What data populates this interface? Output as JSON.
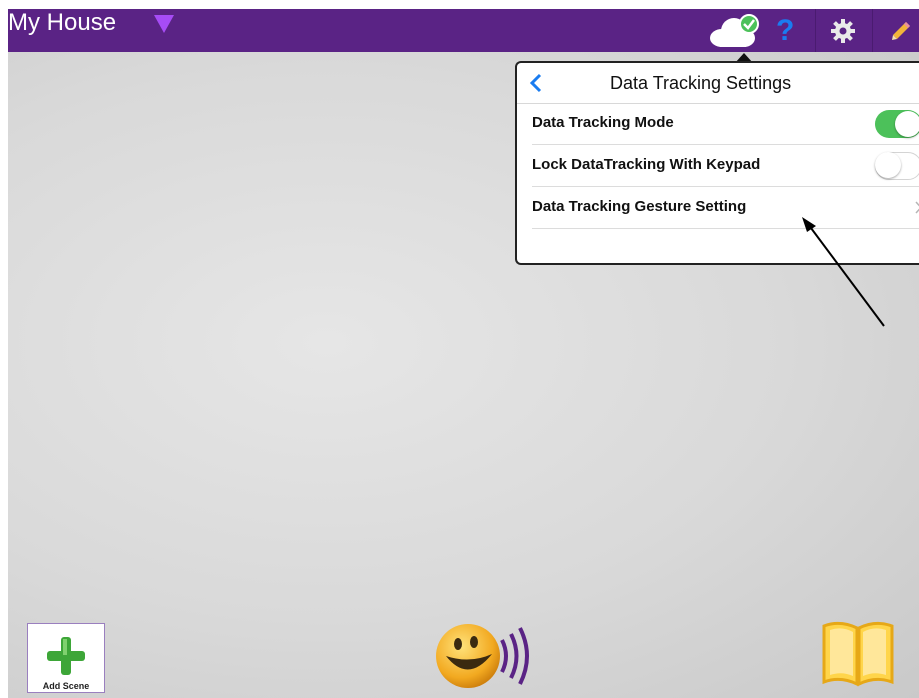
{
  "header": {
    "title": "My House",
    "icons": [
      "dropdown-caret-icon",
      "cloud-sync-icon",
      "help-icon",
      "gear-icon",
      "pencil-icon"
    ]
  },
  "popover": {
    "title": "Data Tracking Settings",
    "rows": [
      {
        "label": "Data Tracking Mode",
        "control": "toggle",
        "state": "on"
      },
      {
        "label": "Lock DataTracking With Keypad",
        "control": "toggle",
        "state": "off"
      },
      {
        "label": "Data Tracking Gesture Setting",
        "control": "chevron"
      }
    ]
  },
  "footer": {
    "add_scene_label": "Add Scene",
    "icons": [
      "add-scene-icon",
      "speak-smiley-icon",
      "book-icon"
    ]
  },
  "colors": {
    "header_bg": "#5a2385",
    "toggle_on": "#4cc15a",
    "accent_blue": "#1a7cf0",
    "caret_purple": "#a64cf5"
  }
}
